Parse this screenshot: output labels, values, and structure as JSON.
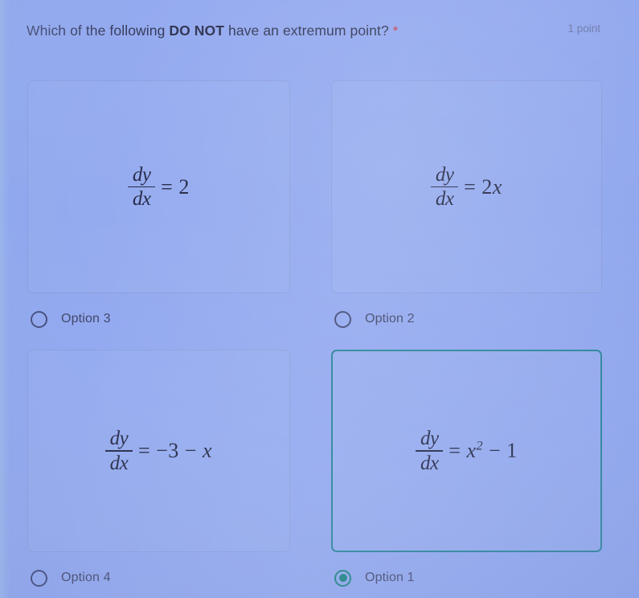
{
  "question": {
    "text_before_bold": "Which of the following ",
    "bold_text": "DO NOT",
    "text_after_bold": " have an extremum point?",
    "required_marker": "*",
    "points": "1 point"
  },
  "colors": {
    "background": "#8fa6ef",
    "selected_border": "#1f7f93",
    "selected_radio": "#0e7d78",
    "required_star": "#c8394a",
    "text": "#2c3152"
  },
  "options": [
    {
      "id": "option-3",
      "label": "Option 3",
      "selected": false,
      "formula": {
        "numerator": "dy",
        "denominator": "dx",
        "rhs_prefix": "= 2",
        "rhs_var": "",
        "rhs_sup": "",
        "rhs_suffix": ""
      },
      "formula_plain": "dy/dx = 2"
    },
    {
      "id": "option-2",
      "label": "Option 2",
      "selected": false,
      "formula": {
        "numerator": "dy",
        "denominator": "dx",
        "rhs_prefix": "= 2",
        "rhs_var": "x",
        "rhs_sup": "",
        "rhs_suffix": ""
      },
      "formula_plain": "dy/dx = 2x"
    },
    {
      "id": "option-4",
      "label": "Option 4",
      "selected": false,
      "formula": {
        "numerator": "dy",
        "denominator": "dx",
        "rhs_prefix": "= −3 − ",
        "rhs_var": "x",
        "rhs_sup": "",
        "rhs_suffix": ""
      },
      "formula_plain": "dy/dx = -3 - x"
    },
    {
      "id": "option-1",
      "label": "Option 1",
      "selected": true,
      "formula": {
        "numerator": "dy",
        "denominator": "dx",
        "rhs_prefix": "= ",
        "rhs_var": "x",
        "rhs_sup": "2",
        "rhs_suffix": " − 1"
      },
      "formula_plain": "dy/dx = x^2 - 1"
    }
  ]
}
